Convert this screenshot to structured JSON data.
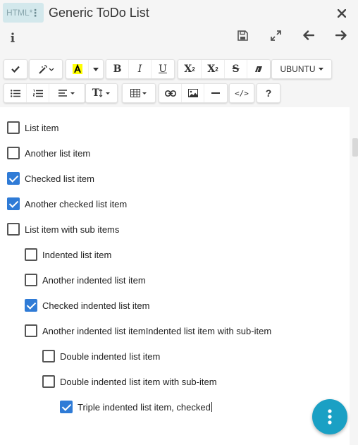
{
  "header": {
    "badge_label": "HTML*",
    "badge_menu_glyph": "⋮",
    "title": "Generic ToDo List",
    "icons": [
      "close-icon",
      "info-icon",
      "save-icon",
      "expand-icon",
      "arrow-left-icon",
      "arrow-right-icon"
    ]
  },
  "toolbar": {
    "font_name": "UBUNTU",
    "superscript": "X",
    "subscript": "X",
    "help": "?",
    "bold": "B",
    "italic": "I",
    "underline": "U",
    "strike": "S",
    "text_size": "T",
    "code": "</>"
  },
  "todos": [
    {
      "label": "List item",
      "checked": false,
      "level": 0
    },
    {
      "label": "Another list item",
      "checked": false,
      "level": 0
    },
    {
      "label": "Checked list item",
      "checked": true,
      "level": 0
    },
    {
      "label": "Another checked list item",
      "checked": true,
      "level": 0
    },
    {
      "label": "List item with sub items",
      "checked": false,
      "level": 0
    },
    {
      "label": "Indented list item",
      "checked": false,
      "level": 1
    },
    {
      "label": "Another indented list item",
      "checked": false,
      "level": 1
    },
    {
      "label": "Checked indented list item",
      "checked": true,
      "level": 1
    },
    {
      "label": "Another  indented list itemIndented list item with sub-item",
      "checked": false,
      "level": 1
    },
    {
      "label": "Double indented list item",
      "checked": false,
      "level": 2
    },
    {
      "label": "Double indented list item with sub-item",
      "checked": false,
      "level": 2
    },
    {
      "label": "Triple indented list item, checked",
      "checked": true,
      "level": 3
    }
  ],
  "colors": {
    "accent": "#2f7bd6",
    "fab": "#1aa0c4",
    "highlight": "#ffff00"
  }
}
